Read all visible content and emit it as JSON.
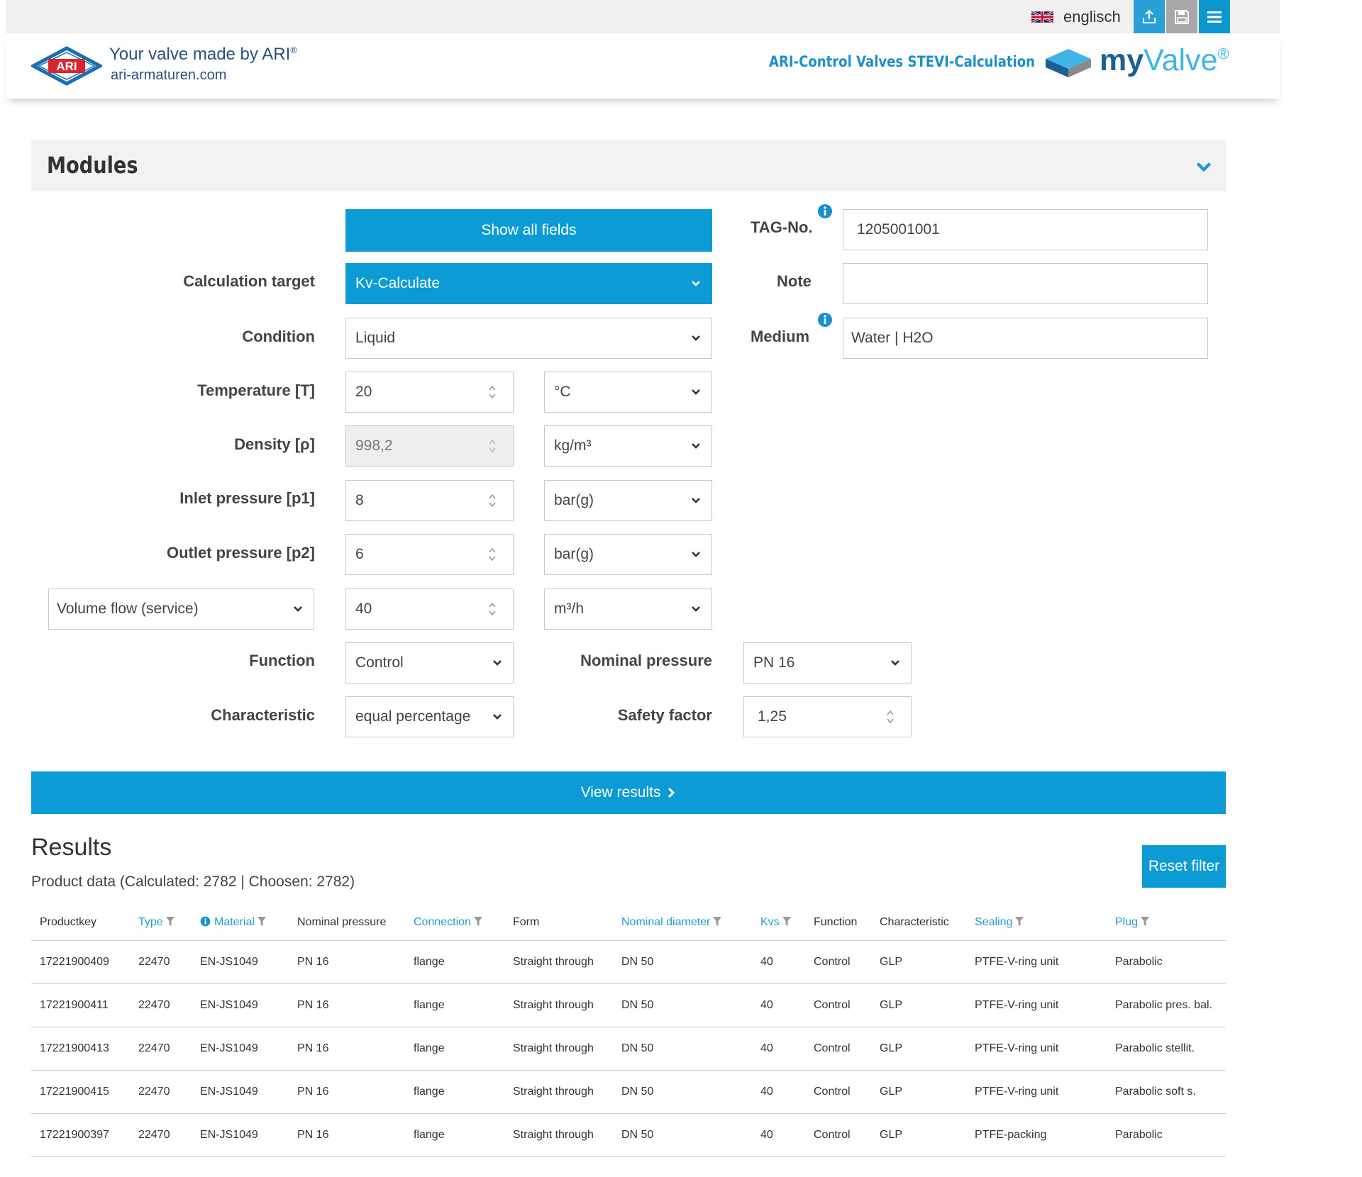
{
  "topbar": {
    "language": "englisch",
    "icons": [
      "uk-flag-icon",
      "upload-icon",
      "save-icon",
      "menu-icon"
    ],
    "colors": {
      "upload": "#29a1d8",
      "save": "#a8a8a8",
      "menu": "#0b96d0"
    }
  },
  "header": {
    "logo_text": "ARI",
    "slogan": "Your valve made by ARI",
    "slogan_reg": "®",
    "website": "ari-armaturen.com",
    "app_title": "ARI-Control Valves STEVI-Calculation",
    "brand_my": "my",
    "brand_valve": "Valve",
    "brand_reg": "®"
  },
  "modules": {
    "title": "Modules"
  },
  "form": {
    "show_all_fields": "Show all fields",
    "calc_target_label": "Calculation target",
    "calc_target_value": "Kv-Calculate",
    "condition_label": "Condition",
    "condition_value": "Liquid",
    "temperature_label": "Temperature [T]",
    "temperature_value": "20",
    "temperature_unit": "°C",
    "density_label": "Density [ρ]",
    "density_value": "998,2",
    "density_unit": "kg/m³",
    "inlet_label": "Inlet pressure [p1]",
    "inlet_value": "8",
    "inlet_unit": "bar(g)",
    "outlet_label": "Outlet pressure [p2]",
    "outlet_value": "6",
    "outlet_unit": "bar(g)",
    "flow_type": "Volume flow (service)",
    "flow_value": "40",
    "flow_unit": "m³/h",
    "function_label": "Function",
    "function_value": "Control",
    "characteristic_label": "Characteristic",
    "characteristic_value": "equal percentage",
    "nominal_pressure_label": "Nominal pressure",
    "nominal_pressure_value": "PN 16",
    "safety_factor_label": "Safety factor",
    "safety_factor_value": "1,25",
    "tag_label": "TAG-No.",
    "tag_value": "1205001001",
    "note_label": "Note",
    "note_value": "",
    "medium_label": "Medium",
    "medium_value": "Water | H2O",
    "view_results": "View results"
  },
  "results": {
    "title": "Results",
    "subtitle": "Product data (Calculated: 2782 | Choosen: 2782)",
    "reset_filter": "Reset filter",
    "columns": [
      "Productkey",
      "Type",
      "Material",
      "Nominal pressure",
      "Connection",
      "Form",
      "Nominal diameter",
      "Kvs",
      "Function",
      "Characteristic",
      "Sealing",
      "Plug"
    ],
    "rows": [
      [
        "17221900409",
        "22470",
        "EN-JS1049",
        "PN 16",
        "flange",
        "Straight through",
        "DN 50",
        "40",
        "Control",
        "GLP",
        "PTFE-V-ring unit",
        "Parabolic"
      ],
      [
        "17221900411",
        "22470",
        "EN-JS1049",
        "PN 16",
        "flange",
        "Straight through",
        "DN 50",
        "40",
        "Control",
        "GLP",
        "PTFE-V-ring unit",
        "Parabolic pres. bal."
      ],
      [
        "17221900413",
        "22470",
        "EN-JS1049",
        "PN 16",
        "flange",
        "Straight through",
        "DN 50",
        "40",
        "Control",
        "GLP",
        "PTFE-V-ring unit",
        "Parabolic stellit."
      ],
      [
        "17221900415",
        "22470",
        "EN-JS1049",
        "PN 16",
        "flange",
        "Straight through",
        "DN 50",
        "40",
        "Control",
        "GLP",
        "PTFE-V-ring unit",
        "Parabolic soft s."
      ],
      [
        "17221900397",
        "22470",
        "EN-JS1049",
        "PN 16",
        "flange",
        "Straight through",
        "DN 50",
        "40",
        "Control",
        "GLP",
        "PTFE-packing",
        "Parabolic"
      ]
    ]
  },
  "colors": {
    "accent": "#0c9bd5",
    "link": "#2a9bd3",
    "brand_dark": "#2d4f7f"
  }
}
